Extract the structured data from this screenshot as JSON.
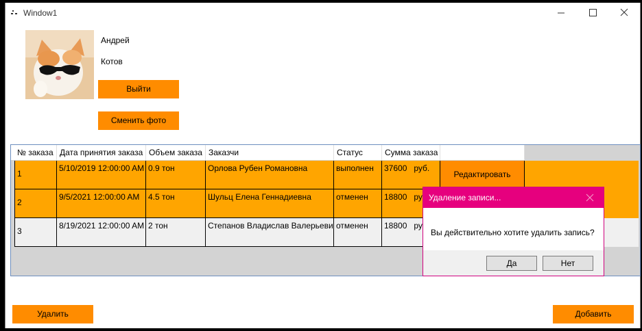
{
  "window": {
    "title": "Window1"
  },
  "user": {
    "first_name": "Андрей",
    "last_name": "Котов"
  },
  "buttons": {
    "logout": "Выйти",
    "change_photo": "Сменить фото",
    "delete": "Удалить",
    "add": "Добавить"
  },
  "table": {
    "columns": [
      "№ заказа",
      "Дата принятия заказа",
      "Объем заказа",
      "Заказчи",
      "Статус",
      "Сумма заказа"
    ],
    "rows": [
      {
        "id": "1",
        "date": "5/10/2019 12:00:00 AM",
        "volume": "0.9 тон",
        "customer": "Орлова Рубен Романовна",
        "status": "выполнен",
        "sum": "37600",
        "currency": "руб.",
        "edit_label": "Редактировать",
        "bg": "#ffa500"
      },
      {
        "id": "2",
        "date": "9/5/2021 12:00:00 AM",
        "volume": "4.5 тон",
        "customer": "Шульц Елена Геннадиевна",
        "status": "отменен",
        "sum": "18800",
        "currency": "руб.",
        "bg": "#ffa500"
      },
      {
        "id": "3",
        "date": "8/19/2021 12:00:00 AM",
        "volume": "2 тон",
        "customer": "Степанов Владислав Валерьевич",
        "status": "отменен",
        "sum": "18800",
        "currency": "руб.",
        "bg": "#f0f0f0"
      }
    ]
  },
  "dialog": {
    "title": "Удаление записи...",
    "message": "Вы действительно хотите удалить запись?",
    "yes": "Да",
    "no": "Нет"
  },
  "colors": {
    "accent": "#ff8c00",
    "row_highlight": "#ffa500",
    "dialog_title": "#e6007e"
  }
}
